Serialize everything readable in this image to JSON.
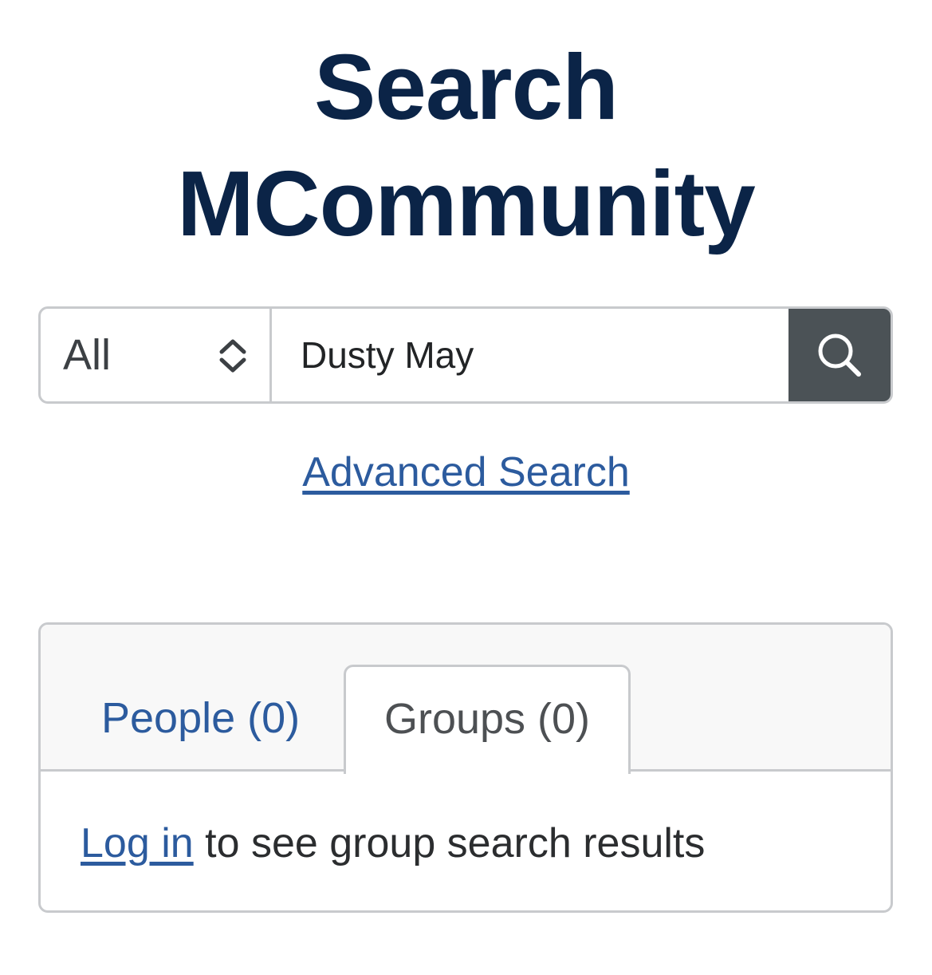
{
  "page": {
    "title_line1": "Search",
    "title_line2": "MCommunity"
  },
  "search": {
    "scope_selected": "All",
    "query_value": "Dusty May"
  },
  "links": {
    "advanced_search": "Advanced Search"
  },
  "results": {
    "tabs": [
      {
        "label": "People (0)",
        "active": false
      },
      {
        "label": "Groups (0)",
        "active": true
      }
    ],
    "login_link": "Log in",
    "login_message": " to see group search results"
  },
  "colors": {
    "title": "#0b2447",
    "link": "#2c5b9e",
    "search_button_bg": "#4b5256",
    "border": "#c8cacd"
  },
  "icons": {
    "scope_select": "chevron-up-down-icon",
    "search_button": "search-icon"
  }
}
